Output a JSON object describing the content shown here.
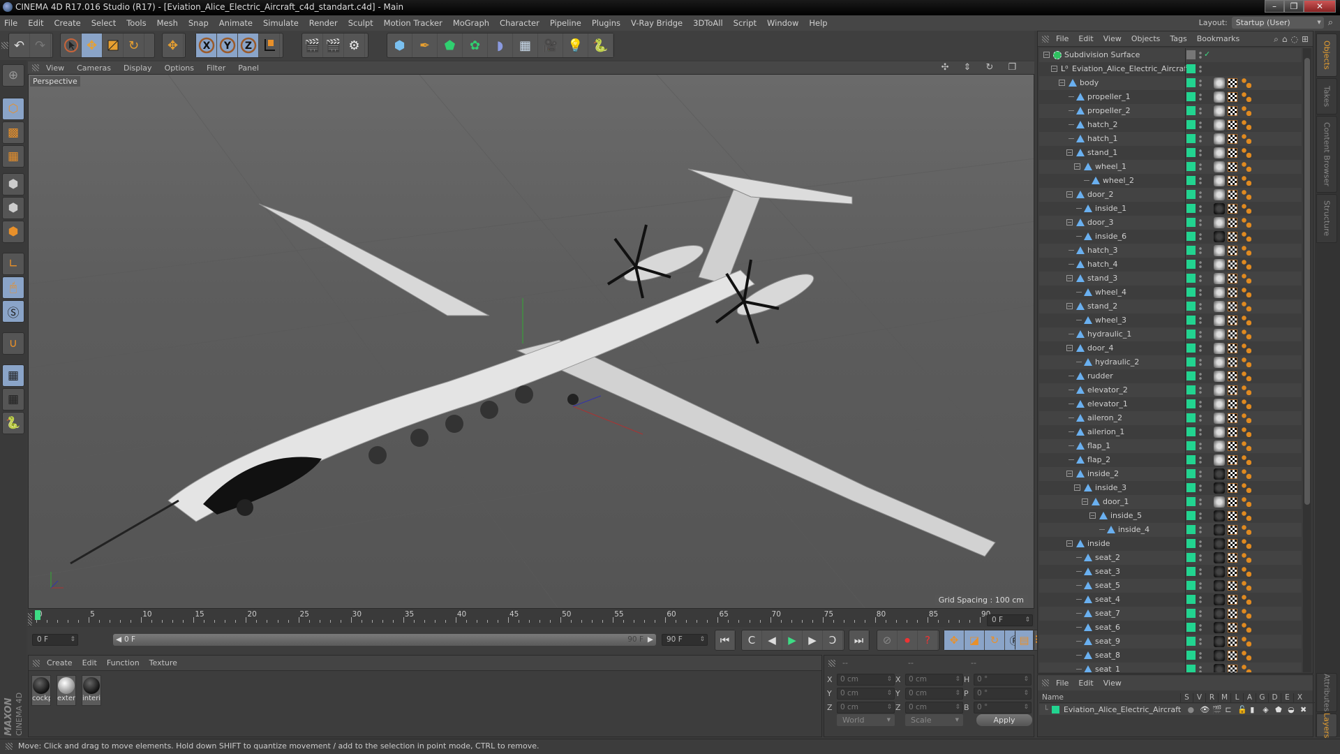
{
  "window": {
    "title": "CINEMA 4D R17.016 Studio (R17) - [Eviation_Alice_Electric_Aircraft_c4d_standart.c4d] - Main",
    "controls": {
      "minimize": "–",
      "maximize": "❐",
      "close": "✕"
    }
  },
  "menubar": [
    "File",
    "Edit",
    "Create",
    "Select",
    "Tools",
    "Mesh",
    "Snap",
    "Animate",
    "Simulate",
    "Render",
    "Sculpt",
    "Motion Tracker",
    "MoGraph",
    "Character",
    "Pipeline",
    "Plugins",
    "V-Ray Bridge",
    "3DToAll",
    "Script",
    "Window",
    "Help"
  ],
  "layout": {
    "label": "Layout:",
    "value": "Startup (User)"
  },
  "toolbar": {
    "undo": "undo-icon",
    "redo": "redo-icon",
    "modes": [
      "select-icon",
      "move-icon",
      "scale-icon",
      "rotate-icon"
    ],
    "last_tool": "move-icon",
    "axes": [
      "X",
      "Y",
      "Z"
    ],
    "coord_system": "world-coordinates-icon",
    "render": [
      "render-view-icon",
      "render-picture-viewer-icon",
      "render-settings-icon"
    ],
    "objects": [
      "cube-icon",
      "pen-spline-icon",
      "subdivision-icon",
      "cloner-icon",
      "deformer-icon",
      "floor-icon",
      "camera-icon",
      "light-icon",
      "python-icon"
    ]
  },
  "left_tools": [
    "make-editable-icon",
    "model-mode-icon",
    "texture-mode-icon",
    "workplane-mode-icon",
    "points-mode-icon",
    "edges-mode-icon",
    "polygons-mode-icon",
    "axis-mode-icon",
    "tweak-mode-icon",
    "solo-icon",
    "snap-icon",
    "locked-workplane-icon",
    "planar-workplane-icon",
    "python-icon"
  ],
  "viewport": {
    "menu": [
      "View",
      "Cameras",
      "Display",
      "Options",
      "Filter",
      "Panel"
    ],
    "camera_label": "Perspective",
    "grid_spacing": "Grid Spacing : 100 cm",
    "nav_icons": [
      "pan-icon",
      "dolly-icon",
      "orbit-icon",
      "maximize-icon"
    ]
  },
  "timeline": {
    "ticks": [
      0,
      5,
      10,
      15,
      20,
      25,
      30,
      35,
      40,
      45,
      50,
      55,
      60,
      65,
      70,
      75,
      80,
      85,
      90
    ],
    "current_frame": "0 F",
    "start_field": "0 F",
    "scrub_start": "0 F",
    "scrub_end": "90 F",
    "end_field": "90 F",
    "end_right_field": "0 F",
    "progress": 0
  },
  "transport": [
    "go-to-start-icon",
    "previous-key-icon",
    "previous-frame-icon",
    "play-icon",
    "next-frame-icon",
    "next-key-icon",
    "go-to-end-icon"
  ],
  "keyframe_tools": [
    "record-keys-off-icon",
    "autokey-icon",
    "keyframe-selection-icon"
  ],
  "key_tracks": [
    "position-track-icon",
    "scale-track-icon",
    "rotation-track-icon",
    "parameter-track-icon",
    "point-level-icon",
    "timeline-icon"
  ],
  "material_panel": {
    "menu": [
      "Create",
      "Edit",
      "Function",
      "Texture"
    ],
    "materials": [
      {
        "name": "cockp",
        "kind": "dark"
      },
      {
        "name": "exter",
        "kind": "light"
      },
      {
        "name": "interi",
        "kind": "dark"
      }
    ],
    "branding": {
      "maxon": "MAXON",
      "product": "CINEMA 4D"
    }
  },
  "coords": {
    "headers": [
      "--",
      "--",
      "--"
    ],
    "rows": [
      {
        "a": "X",
        "av": "0 cm",
        "b": "X",
        "bv": "0 cm",
        "c": "H",
        "cv": "0 °"
      },
      {
        "a": "Y",
        "av": "0 cm",
        "b": "Y",
        "bv": "0 cm",
        "c": "P",
        "cv": "0 °"
      },
      {
        "a": "Z",
        "av": "0 cm",
        "b": "Z",
        "bv": "0 cm",
        "c": "B",
        "cv": "0 °"
      }
    ],
    "space": "World",
    "mode": "Scale",
    "apply": "Apply"
  },
  "object_manager": {
    "menu": [
      "File",
      "Edit",
      "View",
      "Objects",
      "Tags",
      "Bookmarks"
    ],
    "objects": [
      {
        "name": "Subdivision Surface",
        "depth": 0,
        "expand": true,
        "type": "subdivision",
        "tags": false
      },
      {
        "name": "Eviation_Alice_Electric_Aircraft",
        "depth": 1,
        "expand": true,
        "type": "null",
        "tags": false
      },
      {
        "name": "body",
        "depth": 2,
        "expand": true,
        "type": "poly",
        "mat": "light"
      },
      {
        "name": "propeller_1",
        "depth": 3,
        "type": "poly",
        "mat": "light"
      },
      {
        "name": "propeller_2",
        "depth": 3,
        "type": "poly",
        "mat": "light"
      },
      {
        "name": "hatch_2",
        "depth": 3,
        "type": "poly",
        "mat": "light"
      },
      {
        "name": "hatch_1",
        "depth": 3,
        "type": "poly",
        "mat": "light"
      },
      {
        "name": "stand_1",
        "depth": 3,
        "expand": true,
        "type": "poly",
        "mat": "light"
      },
      {
        "name": "wheel_1",
        "depth": 4,
        "expand": true,
        "type": "poly",
        "mat": "light"
      },
      {
        "name": "wheel_2",
        "depth": 5,
        "type": "poly",
        "mat": "light"
      },
      {
        "name": "door_2",
        "depth": 3,
        "expand": true,
        "type": "poly",
        "mat": "light"
      },
      {
        "name": "inside_1",
        "depth": 4,
        "type": "poly",
        "mat": "dark"
      },
      {
        "name": "door_3",
        "depth": 3,
        "expand": true,
        "type": "poly",
        "mat": "light"
      },
      {
        "name": "inside_6",
        "depth": 4,
        "type": "poly",
        "mat": "dark"
      },
      {
        "name": "hatch_3",
        "depth": 3,
        "type": "poly",
        "mat": "light"
      },
      {
        "name": "hatch_4",
        "depth": 3,
        "type": "poly",
        "mat": "light"
      },
      {
        "name": "stand_3",
        "depth": 3,
        "expand": true,
        "type": "poly",
        "mat": "light"
      },
      {
        "name": "wheel_4",
        "depth": 4,
        "type": "poly",
        "mat": "light"
      },
      {
        "name": "stand_2",
        "depth": 3,
        "expand": true,
        "type": "poly",
        "mat": "light"
      },
      {
        "name": "wheel_3",
        "depth": 4,
        "type": "poly",
        "mat": "light"
      },
      {
        "name": "hydraulic_1",
        "depth": 3,
        "type": "poly",
        "mat": "light"
      },
      {
        "name": "door_4",
        "depth": 3,
        "expand": true,
        "type": "poly",
        "mat": "light"
      },
      {
        "name": "hydraulic_2",
        "depth": 4,
        "type": "poly",
        "mat": "light"
      },
      {
        "name": "rudder",
        "depth": 3,
        "type": "poly",
        "mat": "light"
      },
      {
        "name": "elevator_2",
        "depth": 3,
        "type": "poly",
        "mat": "light"
      },
      {
        "name": "elevator_1",
        "depth": 3,
        "type": "poly",
        "mat": "light"
      },
      {
        "name": "aileron_2",
        "depth": 3,
        "type": "poly",
        "mat": "light"
      },
      {
        "name": "ailerion_1",
        "depth": 3,
        "type": "poly",
        "mat": "light"
      },
      {
        "name": "flap_1",
        "depth": 3,
        "type": "poly",
        "mat": "light"
      },
      {
        "name": "flap_2",
        "depth": 3,
        "type": "poly",
        "mat": "light"
      },
      {
        "name": "inside_2",
        "depth": 3,
        "expand": true,
        "type": "poly",
        "mat": "dark"
      },
      {
        "name": "inside_3",
        "depth": 4,
        "expand": true,
        "type": "poly",
        "mat": "dark"
      },
      {
        "name": "door_1",
        "depth": 5,
        "expand": true,
        "type": "poly",
        "mat": "light"
      },
      {
        "name": "inside_5",
        "depth": 6,
        "expand": true,
        "type": "poly",
        "mat": "dark"
      },
      {
        "name": "inside_4",
        "depth": 7,
        "type": "poly",
        "mat": "dark"
      },
      {
        "name": "inside",
        "depth": 3,
        "expand": true,
        "type": "poly",
        "mat": "dark"
      },
      {
        "name": "seat_2",
        "depth": 4,
        "type": "poly",
        "mat": "dark"
      },
      {
        "name": "seat_3",
        "depth": 4,
        "type": "poly",
        "mat": "dark"
      },
      {
        "name": "seat_5",
        "depth": 4,
        "type": "poly",
        "mat": "dark"
      },
      {
        "name": "seat_4",
        "depth": 4,
        "type": "poly",
        "mat": "dark"
      },
      {
        "name": "seat_7",
        "depth": 4,
        "type": "poly",
        "mat": "dark"
      },
      {
        "name": "seat_6",
        "depth": 4,
        "type": "poly",
        "mat": "dark"
      },
      {
        "name": "seat_9",
        "depth": 4,
        "type": "poly",
        "mat": "dark"
      },
      {
        "name": "seat_8",
        "depth": 4,
        "type": "poly",
        "mat": "dark"
      },
      {
        "name": "seat_1",
        "depth": 4,
        "type": "poly",
        "mat": "dark"
      }
    ]
  },
  "layers_panel": {
    "menu": [
      "File",
      "Edit",
      "View"
    ],
    "columns": [
      "Name",
      "S",
      "V",
      "R",
      "M",
      "L",
      "A",
      "G",
      "D",
      "E",
      "X"
    ],
    "layers": [
      {
        "name": "Eviation_Alice_Electric_Aircraft",
        "color": "#22d490"
      }
    ]
  },
  "side_tabs_top": [
    "Objects",
    "Takes",
    "Content Browser",
    "Structure"
  ],
  "side_tabs_bottom": [
    "Attributes",
    "Layers"
  ],
  "status": "Move: Click and drag to move elements. Hold down SHIFT to quantize movement / add to the selection in point mode, CTRL to remove.",
  "colors": {
    "accent": "#e8a030",
    "selected": "#8aa4c8",
    "layer_green": "#22d490",
    "poly_icon": "#6ab0f0"
  }
}
